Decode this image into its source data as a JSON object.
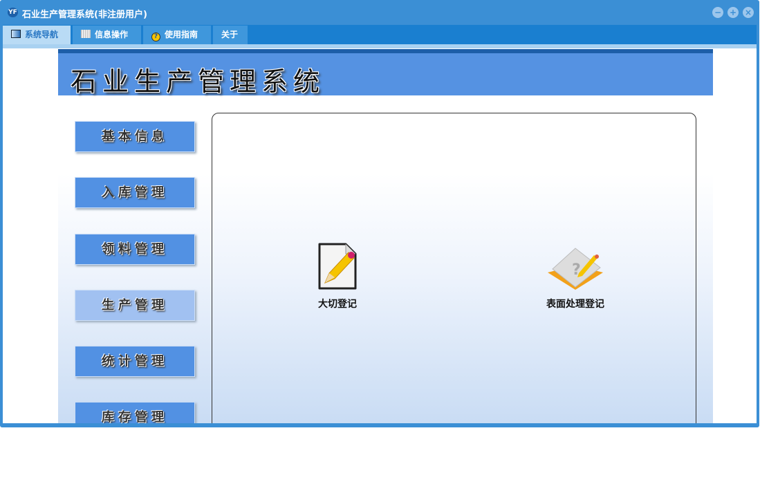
{
  "window": {
    "title": "石业生产管理系统(非注册用户)",
    "app_icon": "YF",
    "minimize": "−",
    "maximize": "+",
    "close": "×"
  },
  "tabs": [
    {
      "label": "系统导航",
      "icon": "monitor-icon"
    },
    {
      "label": "信息操作",
      "icon": "grid-icon"
    },
    {
      "label": "使用指南",
      "icon": "help-icon"
    },
    {
      "label": "关于"
    }
  ],
  "banner": {
    "title": "石业生产管理系统"
  },
  "nav": [
    {
      "label": "基本信息"
    },
    {
      "label": "入库管理"
    },
    {
      "label": "领料管理"
    },
    {
      "label": "生产管理",
      "selected": true
    },
    {
      "label": "统计管理"
    },
    {
      "label": "库存管理"
    }
  ],
  "functions": [
    {
      "label": "大切登记",
      "icon": "edit-document-icon"
    },
    {
      "label": "表面处理登记",
      "icon": "notebook-pencil-icon"
    }
  ],
  "colors": {
    "titlebar": "#3b8fd5",
    "tabbar": "#1a7fd0",
    "banner": "#5592e2",
    "nav_button": "#5291e3"
  }
}
